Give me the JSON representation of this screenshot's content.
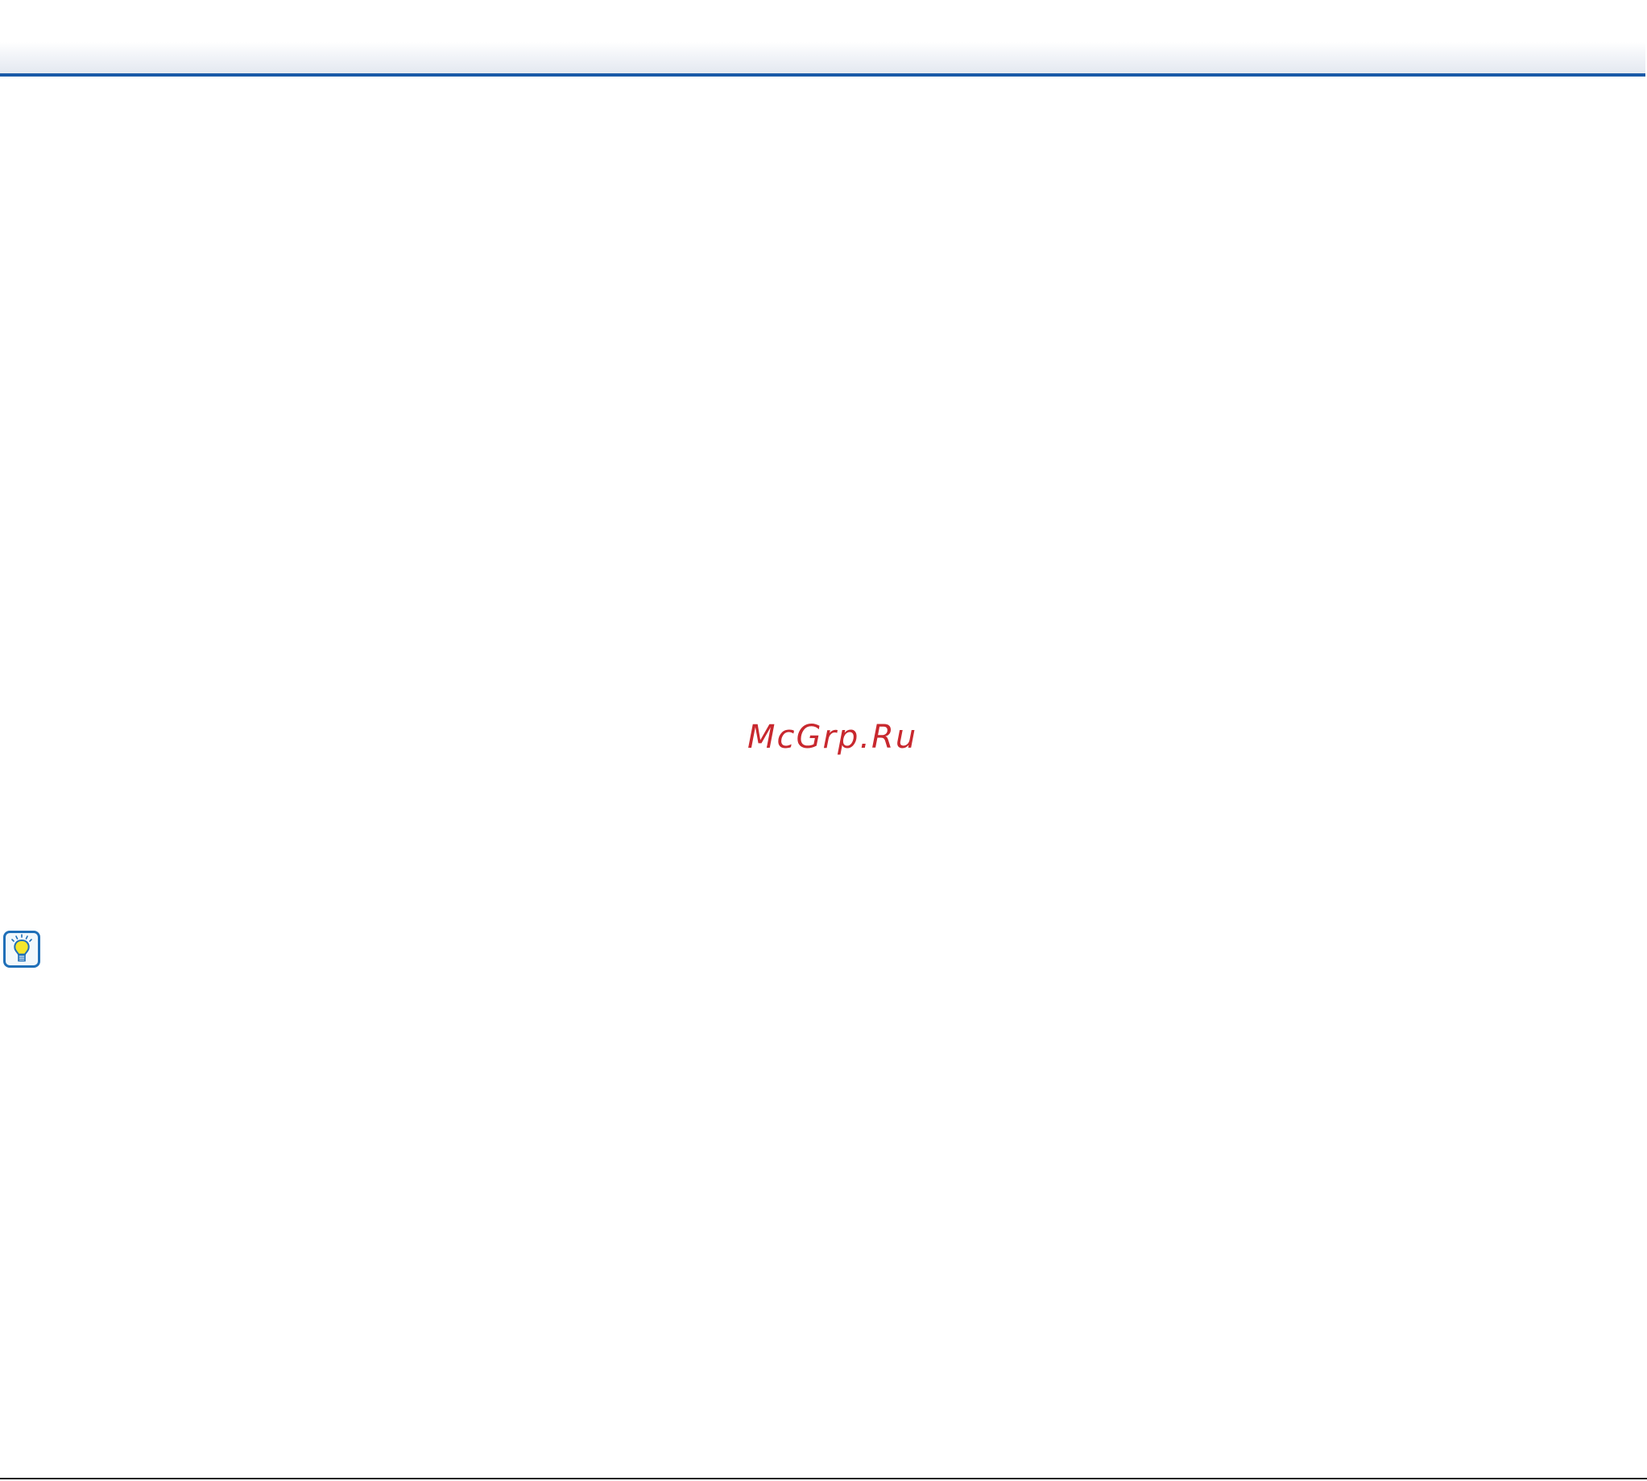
{
  "watermark": {
    "text": "McGrp.Ru",
    "color": "#c8282e"
  },
  "header": {
    "rule_color": "#1a5aa8"
  },
  "hint": {
    "icon": "lightbulb-icon",
    "border_color": "#1f6fb8",
    "bulb_color": "#f5e62c"
  }
}
